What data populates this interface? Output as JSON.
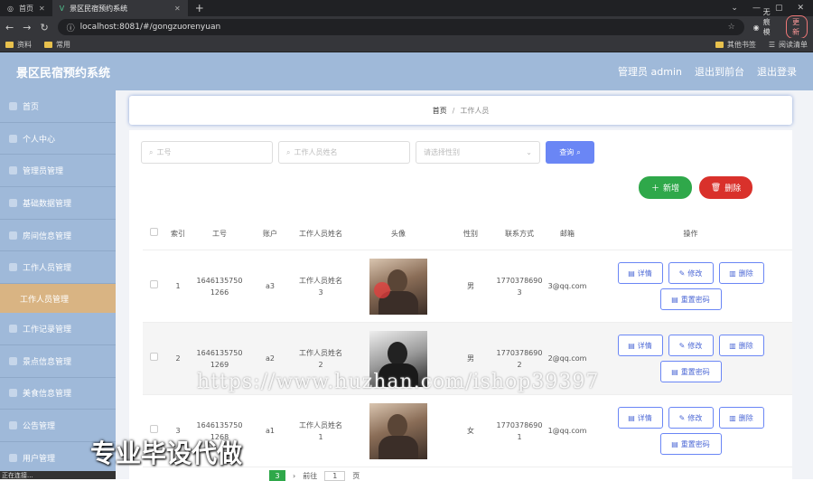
{
  "browser": {
    "tabs": [
      {
        "label": "首页",
        "active": false
      },
      {
        "label": "景区民宿预约系统",
        "active": true
      }
    ],
    "url": "localhost:8081/#/gongzuorenyuan",
    "incognito_label": "无痕模式",
    "update_label": "更新",
    "bookmarks": [
      "资料",
      "常用"
    ],
    "bookmarks_right": [
      "其他书签",
      "阅读清单"
    ]
  },
  "app": {
    "title": "景区民宿预约系统",
    "header_links": [
      "管理员 admin",
      "退出到前台",
      "退出登录"
    ]
  },
  "sidebar": {
    "items": [
      "首页",
      "个人中心",
      "管理员管理",
      "基础数据管理",
      "房间信息管理",
      "工作人员管理"
    ],
    "sub_item": "工作人员管理",
    "items_after": [
      "工作记录管理",
      "景点信息管理",
      "美食信息管理",
      "公告管理",
      "用户管理"
    ]
  },
  "breadcrumb": {
    "home": "首页",
    "sep": "/",
    "current": "工作人员"
  },
  "filters": {
    "id_placeholder": "工号",
    "name_placeholder": "工作人员姓名",
    "sex_placeholder": "请选择性别",
    "query_label": "查询"
  },
  "actions": {
    "add_label": "新增",
    "delete_label": "删除"
  },
  "table": {
    "headers": [
      "索引",
      "工号",
      "账户",
      "工作人员姓名",
      "头像",
      "性别",
      "联系方式",
      "邮箱",
      "操作"
    ],
    "rows": [
      {
        "index": "1",
        "id": "16461357501266",
        "account": "a3",
        "name": "工作人员姓名3",
        "sex": "男",
        "phone": "17703786903",
        "email": "3@qq.com"
      },
      {
        "index": "2",
        "id": "16461357501269",
        "account": "a2",
        "name": "工作人员姓名2",
        "sex": "男",
        "phone": "17703786902",
        "email": "2@qq.com"
      },
      {
        "index": "3",
        "id": "16461357501268",
        "account": "a1",
        "name": "工作人员姓名1",
        "sex": "女",
        "phone": "17703786901",
        "email": "1@qq.com"
      }
    ],
    "ops": {
      "detail": "详情",
      "edit": "修改",
      "delete": "删除",
      "reset_pwd": "重置密码"
    }
  },
  "pager": {
    "current": "3",
    "goto_label": "前往",
    "page_input": "1",
    "page_suffix": "页"
  },
  "status_text": "正在连接...",
  "watermark": "https://www.huzhan.com/ishop39397",
  "promo": "专业毕设代做",
  "colors": {
    "header": "#9fb9d9",
    "primary": "#6a86f5",
    "success": "#2fa84a",
    "danger": "#d9312b",
    "active_sub": "#d9b483"
  }
}
